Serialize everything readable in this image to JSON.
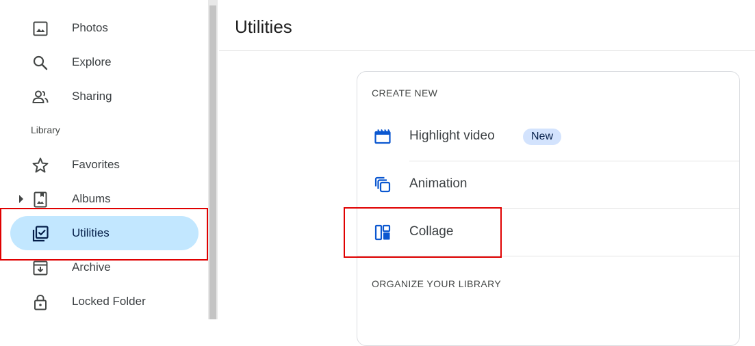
{
  "sidebar": {
    "items_top": [
      {
        "label": "Photos",
        "icon": "photo-icon"
      },
      {
        "label": "Explore",
        "icon": "search-icon"
      },
      {
        "label": "Sharing",
        "icon": "people-icon"
      }
    ],
    "section_label": "Library",
    "items_library": [
      {
        "label": "Favorites",
        "icon": "star-icon"
      },
      {
        "label": "Albums",
        "icon": "album-icon"
      },
      {
        "label": "Utilities",
        "icon": "utilities-icon",
        "active": true
      },
      {
        "label": "Archive",
        "icon": "archive-icon"
      },
      {
        "label": "Locked Folder",
        "icon": "lock-icon"
      }
    ]
  },
  "main": {
    "title": "Utilities",
    "create_new": {
      "heading": "CREATE NEW",
      "items": [
        {
          "label": "Highlight video",
          "icon": "movie-icon",
          "badge": "New"
        },
        {
          "label": "Animation",
          "icon": "animation-icon"
        },
        {
          "label": "Collage",
          "icon": "collage-icon"
        }
      ]
    },
    "organize": {
      "heading": "ORGANIZE YOUR LIBRARY"
    }
  },
  "colors": {
    "active_pill": "#c2e7ff",
    "accent_blue": "#0b57d0",
    "badge_bg": "#d3e3fd",
    "highlight_red": "#e00000"
  }
}
